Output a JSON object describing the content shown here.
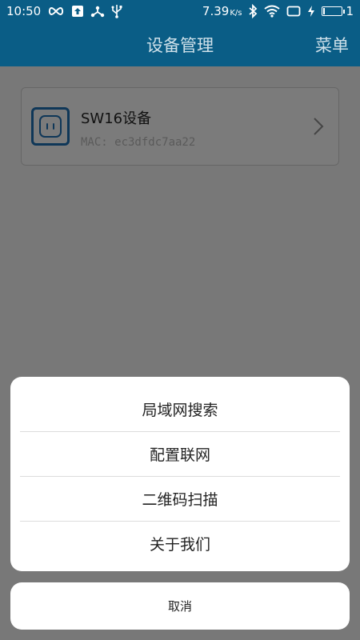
{
  "status_bar": {
    "time": "10:50",
    "speed": "7.39",
    "speed_unit": "K/s",
    "battery_level": "1",
    "icons": [
      "infinity-icon",
      "upload-icon",
      "share-icon",
      "usb-icon",
      "bluetooth-icon",
      "wifi-icon",
      "screen-icon",
      "charging-icon",
      "battery-icon"
    ]
  },
  "app_bar": {
    "title": "设备管理",
    "menu_label": "菜单"
  },
  "device": {
    "name": "SW16设备",
    "mac": "MAC: ec3dfdc7aa22",
    "icon": "smart-socket-icon"
  },
  "action_sheet": {
    "items": [
      {
        "label": "局域网搜索"
      },
      {
        "label": "配置联网"
      },
      {
        "label": "二维码扫描"
      },
      {
        "label": "关于我们"
      }
    ],
    "cancel_label": "取消"
  },
  "colors": {
    "brand": "#0a5d86",
    "icon_blue": "#1f6fb0"
  }
}
